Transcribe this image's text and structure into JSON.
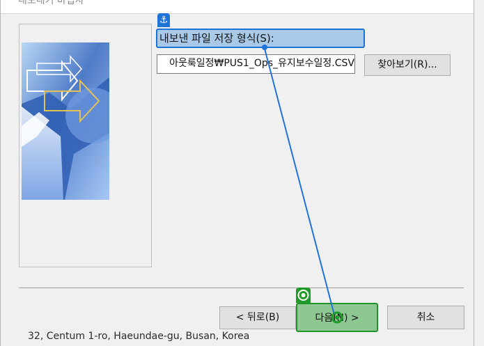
{
  "dialog": {
    "title_fragment": "내보내기 마법사"
  },
  "image_panel": {
    "art_icon": "wizard-arrow-art"
  },
  "form": {
    "format_label": "내보낸 파일 저장 형식(S):",
    "path_value": "아웃룩일정₩PUS1_Ops_유지보수일정.CSV"
  },
  "buttons": {
    "browse": "찾아보기(R)...",
    "back": "< 뒤로(B)",
    "next": "다음(N) >",
    "cancel": "취소"
  },
  "annotations": {
    "anchor_icon": "anchor-icon",
    "target_icon": "target-icon",
    "start_color": "#1f73d9",
    "end_color": "#1f9b2a"
  },
  "background_text": {
    "line": "32, Centum 1-ro, Haeundae-gu, Busan, Korea"
  }
}
